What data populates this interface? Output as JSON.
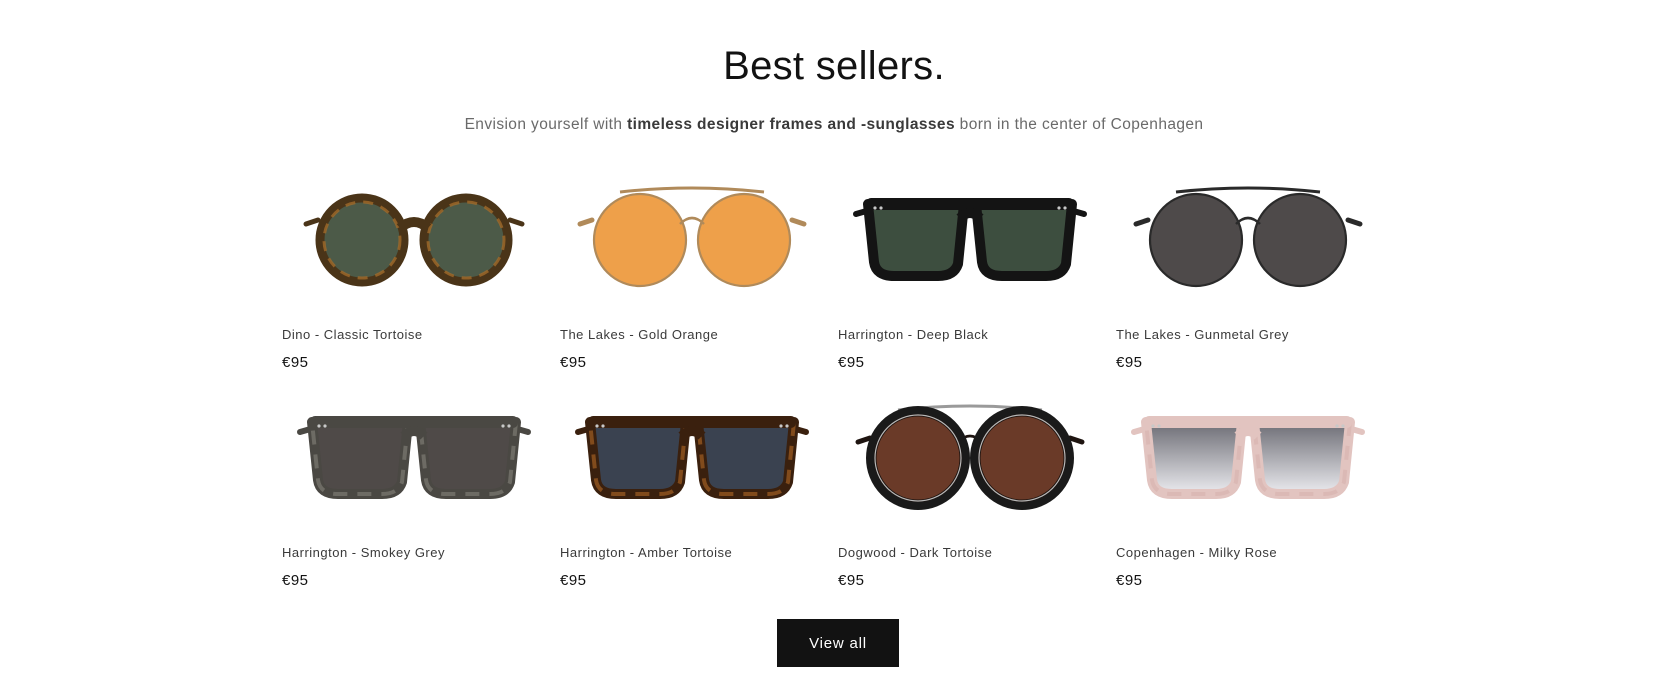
{
  "section": {
    "title": "Best sellers.",
    "subtitle_pre": "Envision yourself with ",
    "subtitle_bold": "timeless designer frames and -sunglasses",
    "subtitle_post": " born in the center of Copenhagen"
  },
  "products": [
    {
      "name": "Dino - Classic Tortoise",
      "price": "€95",
      "frame_color": "#4a3418",
      "frame_accent": "#a06a2a",
      "lens_color": "#4c5a48",
      "shape": "round"
    },
    {
      "name": "The Lakes - Gold Orange",
      "price": "€95",
      "frame_color": "#b08a5a",
      "frame_accent": "#b08a5a",
      "lens_color": "#eea04a",
      "shape": "aviator-round"
    },
    {
      "name": "Harrington - Deep Black",
      "price": "€95",
      "frame_color": "#141414",
      "frame_accent": "#141414",
      "lens_color": "#3d4e3f",
      "shape": "square"
    },
    {
      "name": "The Lakes - Gunmetal Grey",
      "price": "€95",
      "frame_color": "#2a2a2a",
      "frame_accent": "#2a2a2a",
      "lens_color": "#4e4a4a",
      "shape": "aviator-round"
    },
    {
      "name": "Harrington - Smokey Grey",
      "price": "€95",
      "frame_color": "#4a4843",
      "frame_accent": "#7a776f",
      "lens_color": "#4f4a48",
      "shape": "square"
    },
    {
      "name": "Harrington - Amber Tortoise",
      "price": "€95",
      "frame_color": "#3a200e",
      "frame_accent": "#9a5a22",
      "lens_color": "#3a4250",
      "shape": "square"
    },
    {
      "name": "Dogwood - Dark Tortoise",
      "price": "€95",
      "frame_color": "#1e1410",
      "frame_accent": "#4a2a18",
      "lens_color": "#6a3a28",
      "shape": "round-bridge"
    },
    {
      "name": "Copenhagen - Milky Rose",
      "price": "€95",
      "frame_color": "#e2c4c0",
      "frame_accent": "#d8b6b2",
      "lens_color": "#7a7a82",
      "shape": "square-gradient"
    }
  ],
  "view_all_label": "View all"
}
